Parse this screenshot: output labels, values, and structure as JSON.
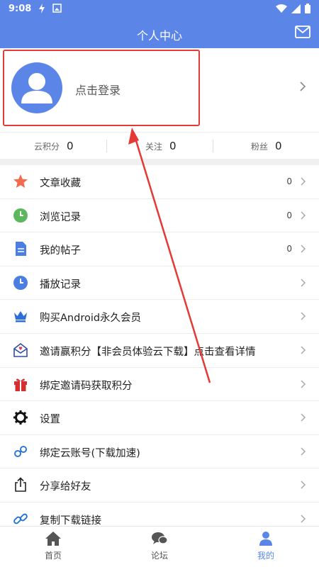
{
  "statusbar": {
    "time": "9:08"
  },
  "header": {
    "title": "个人中心"
  },
  "profile": {
    "login_label": "点击登录"
  },
  "stats": [
    {
      "label": "云积分",
      "value": "0"
    },
    {
      "label": "关注",
      "value": "0"
    },
    {
      "label": "粉丝",
      "value": "0"
    }
  ],
  "menu": [
    {
      "label": "文章收藏",
      "count": "0",
      "icon": "star-icon"
    },
    {
      "label": "浏览记录",
      "count": "0",
      "icon": "clock-icon"
    },
    {
      "label": "我的帖子",
      "count": "0",
      "icon": "document-icon"
    },
    {
      "label": "播放记录",
      "count": "",
      "icon": "clock-icon"
    },
    {
      "label": "购买Android永久会员",
      "count": "",
      "icon": "crown-icon"
    },
    {
      "label": "邀请赢积分【非会员体验云下载】点击查看详情",
      "count": "",
      "icon": "envelope-heart-icon"
    },
    {
      "label": "绑定邀请码获取积分",
      "count": "",
      "icon": "gift-icon"
    },
    {
      "label": "设置",
      "count": "",
      "icon": "gear-icon"
    },
    {
      "label": "绑定云账号(下载加速)",
      "count": "",
      "icon": "cloud-link-icon"
    },
    {
      "label": "分享给好友",
      "count": "",
      "icon": "share-icon"
    },
    {
      "label": "复制下载链接",
      "count": "",
      "icon": "link-icon"
    }
  ],
  "tabs": [
    {
      "label": "首页",
      "icon": "home-icon",
      "active": false
    },
    {
      "label": "论坛",
      "icon": "chat-icon",
      "active": false
    },
    {
      "label": "我的",
      "icon": "user-icon",
      "active": true
    }
  ],
  "colors": {
    "primary": "#5b86e8",
    "highlight": "#e53935"
  }
}
